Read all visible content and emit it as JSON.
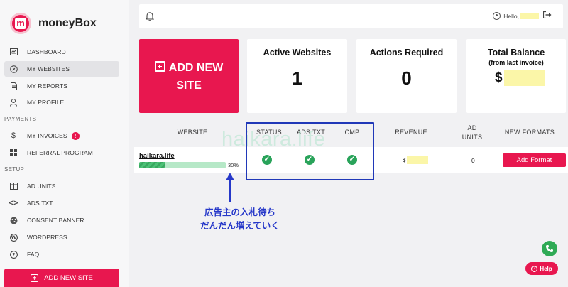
{
  "brand": {
    "logo_letter": "m",
    "name_light": "money",
    "name_bold": "Box"
  },
  "sidebar": {
    "items": [
      {
        "label": "DASHBOARD",
        "icon": "dashboard-icon"
      },
      {
        "label": "MY WEBSITES",
        "icon": "compass-icon",
        "active": true
      },
      {
        "label": "MY REPORTS",
        "icon": "report-icon"
      },
      {
        "label": "MY PROFILE",
        "icon": "user-icon"
      }
    ],
    "payments_label": "PAYMENTS",
    "payments": [
      {
        "label": "MY INVOICES",
        "icon": "dollar-icon",
        "badge": "!"
      },
      {
        "label": "REFERRAL PROGRAM",
        "icon": "grid-icon"
      }
    ],
    "setup_label": "SETUP",
    "setup": [
      {
        "label": "AD UNITS",
        "icon": "columns-icon"
      },
      {
        "label": "ADS.TXT",
        "icon": "code-icon"
      },
      {
        "label": "CONSENT BANNER",
        "icon": "cookie-icon"
      },
      {
        "label": "WORDPRESS",
        "icon": "wordpress-icon"
      },
      {
        "label": "FAQ",
        "icon": "question-icon"
      }
    ],
    "add_site_label": "ADD NEW SITE"
  },
  "topbar": {
    "greeting": "Hello,"
  },
  "cards": {
    "add_new_line1": "ADD NEW",
    "add_new_line2": "SITE",
    "active_websites": {
      "title": "Active Websites",
      "value": "1"
    },
    "actions_required": {
      "title": "Actions Required",
      "value": "0"
    },
    "total_balance": {
      "title": "Total Balance",
      "subtitle": "(from last invoice)",
      "currency": "$"
    }
  },
  "table": {
    "headers": {
      "website": "WEBSITE",
      "status": "STATUS",
      "ads_txt": "ADS.TXT",
      "cmp": "CMP",
      "revenue": "REVENUE",
      "ad_units_1": "AD",
      "ad_units_2": "UNITS",
      "new_formats": "NEW FORMATS"
    },
    "row": {
      "site": "haikara.life",
      "progress_text": "30%",
      "progress_value": 0.3,
      "revenue_currency": "$",
      "ad_units": "0",
      "add_format_label": "Add Format"
    }
  },
  "overlay": {
    "watermark": "haikara.life",
    "annotation_line1": "広告主の入札待ち",
    "annotation_line2": "だんだん増えていく"
  },
  "help_label": "Help",
  "colors": {
    "brand": "#e8174f",
    "success": "#29a35a",
    "annotation": "#2638c9",
    "highlight": "#fbf6a8"
  }
}
